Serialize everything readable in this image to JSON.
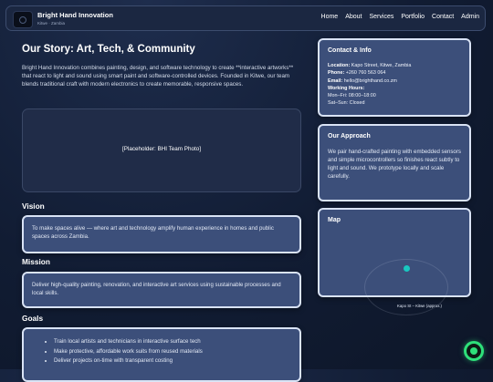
{
  "header": {
    "brand_name": "Bright Hand Innovation",
    "brand_location": "Kitwe · Zambia",
    "nav": [
      "Home",
      "About",
      "Services",
      "Portfolio",
      "Contact",
      "Admin"
    ]
  },
  "main": {
    "title": "Our Story: Art, Tech, & Community",
    "intro": "Bright Hand Innovation combines painting, design, and software technology to create **interactive artworks** that react to light and sound using smart paint and software-controlled devices. Founded in Kitwe, our team blends traditional craft with modern electronics to create memorable, responsive spaces.",
    "photo_placeholder": "[Placeholder: BHI Team Photo]",
    "vision": {
      "heading": "Vision",
      "text": "To make spaces alive — where art and technology amplify human experience in homes and public spaces across Zambia."
    },
    "mission": {
      "heading": "Mission",
      "text": "Deliver high-quality painting, renovation, and interactive art services using sustainable processes and local skills."
    },
    "goals": {
      "heading": "Goals",
      "items": [
        "Train local artists and technicians in interactive surface tech",
        "Make protective, affordable work suits from reused materials",
        "Deliver projects on-time with transparent costing"
      ]
    }
  },
  "sidebar": {
    "contact": {
      "title": "Contact & Info",
      "location_label": "Location:",
      "location_value": "Kapo Street, Kitwe, Zambia",
      "phone_label": "Phone:",
      "phone_value": "+260 760 563 064",
      "email_label": "Email:",
      "email_value": "hello@brighthand.co.zm",
      "hours_label": "Working Hours:",
      "hours_weekday": "Mon–Fri: 08:00–18:00",
      "hours_weekend": "Sat–Sun: Closed"
    },
    "approach": {
      "title": "Our Approach",
      "text": "We pair hand-crafted painting with embedded sensors and simple microcontrollers so finishes react subtly to light and sound. We prototype locally and scale carefully."
    },
    "map": {
      "title": "Map",
      "caption": "Kapo St – Kitwe (approx.)"
    }
  },
  "colors": {
    "background": "#111c33",
    "card": "#3c4f7a",
    "card_border": "#d9e3f5",
    "map_marker": "#19c7c0",
    "chat_button": "#2ee07a"
  },
  "icons": {
    "logo": "logo-icon",
    "map_marker": "map-pin-icon",
    "chat_button": "chat-icon"
  }
}
